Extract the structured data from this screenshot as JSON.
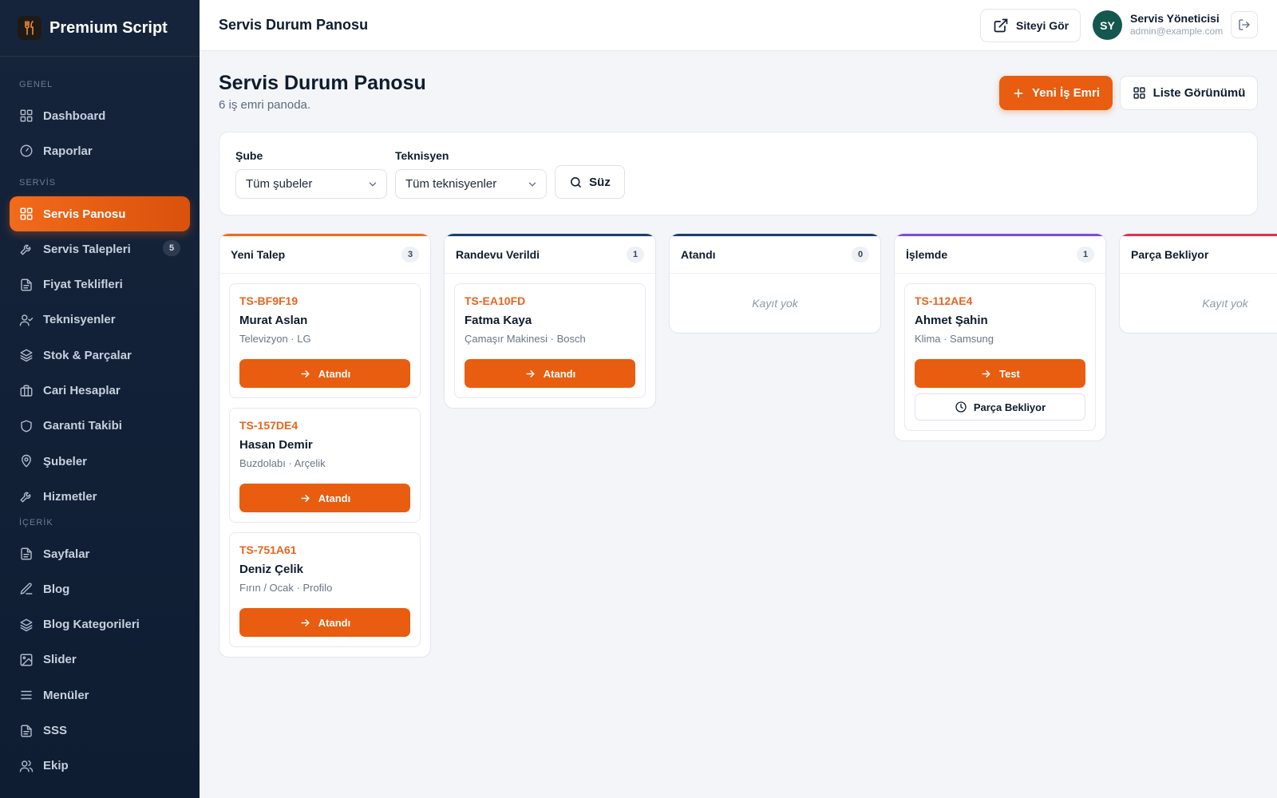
{
  "brand": {
    "name": "Premium Script",
    "logo_icon": "fork-knife-icon"
  },
  "sidebar": {
    "sections": [
      {
        "title": "GENEL",
        "items": [
          {
            "label": "Dashboard",
            "icon": "grid-icon"
          },
          {
            "label": "Raporlar",
            "icon": "gauge-icon"
          }
        ]
      },
      {
        "title": "SERVİS",
        "items": [
          {
            "label": "Servis Panosu",
            "icon": "grid-icon",
            "active": true
          },
          {
            "label": "Servis Talepleri",
            "icon": "wrench-icon",
            "badge": "5"
          },
          {
            "label": "Fiyat Teklifleri",
            "icon": "document-icon"
          },
          {
            "label": "Teknisyenler",
            "icon": "user-check-icon"
          },
          {
            "label": "Stok & Parçalar",
            "icon": "layers-icon"
          },
          {
            "label": "Cari Hesaplar",
            "icon": "briefcase-icon"
          },
          {
            "label": "Garanti Takibi",
            "icon": "shield-icon"
          },
          {
            "label": "Şubeler",
            "icon": "map-pin-icon"
          },
          {
            "label": "Hizmetler",
            "icon": "wrench-icon"
          }
        ]
      },
      {
        "title": "İÇERİK",
        "items": [
          {
            "label": "Sayfalar",
            "icon": "document-icon"
          },
          {
            "label": "Blog",
            "icon": "edit-icon"
          },
          {
            "label": "Blog Kategorileri",
            "icon": "layers-icon"
          },
          {
            "label": "Slider",
            "icon": "image-icon"
          },
          {
            "label": "Menüler",
            "icon": "menu-icon"
          },
          {
            "label": "SSS",
            "icon": "document-icon"
          },
          {
            "label": "Ekip",
            "icon": "users-icon"
          }
        ]
      }
    ]
  },
  "topbar": {
    "title": "Servis Durum Panosu",
    "site_button": "Siteyi Gör",
    "user": {
      "initials": "SY",
      "name": "Servis Yöneticisi",
      "email": "admin@example.com"
    }
  },
  "page": {
    "title": "Servis Durum Panosu",
    "subtitle": "6 iş emri panoda.",
    "new_order_button": "Yeni İş Emri",
    "list_view_button": "Liste Görünümü"
  },
  "filters": {
    "branch_label": "Şube",
    "branch_value": "Tüm şubeler",
    "tech_label": "Teknisyen",
    "tech_value": "Tüm teknisyenler",
    "submit": "Süz"
  },
  "board": {
    "empty_text": "Kayıt yok",
    "columns": [
      {
        "title": "Yeni Talep",
        "count": "3",
        "color": "#f26a1b",
        "cards": [
          {
            "code": "TS-BF9F19",
            "name": "Murat Aslan",
            "meta": "Televizyon · LG",
            "action": "Atandı"
          },
          {
            "code": "TS-157DE4",
            "name": "Hasan Demir",
            "meta": "Buzdolabı · Arçelik",
            "action": "Atandı"
          },
          {
            "code": "TS-751A61",
            "name": "Deniz Çelik",
            "meta": "Fırın / Ocak · Profilo",
            "action": "Atandı"
          }
        ]
      },
      {
        "title": "Randevu Verildi",
        "count": "1",
        "color": "#1f3e6e",
        "cards": [
          {
            "code": "TS-EA10FD",
            "name": "Fatma Kaya",
            "meta": "Çamaşır Makinesi · Bosch",
            "action": "Atandı"
          }
        ]
      },
      {
        "title": "Atandı",
        "count": "0",
        "color": "#1f3e6e",
        "cards": []
      },
      {
        "title": "İşlemde",
        "count": "1",
        "color": "#7c4ddb",
        "cards": [
          {
            "code": "TS-112AE4",
            "name": "Ahmet Şahin",
            "meta": "Klima · Samsung",
            "action": "Test",
            "secondary": "Parça Bekliyor"
          }
        ]
      },
      {
        "title": "Parça Bekliyor",
        "count": "",
        "color": "#e0314f",
        "cards": []
      }
    ]
  }
}
